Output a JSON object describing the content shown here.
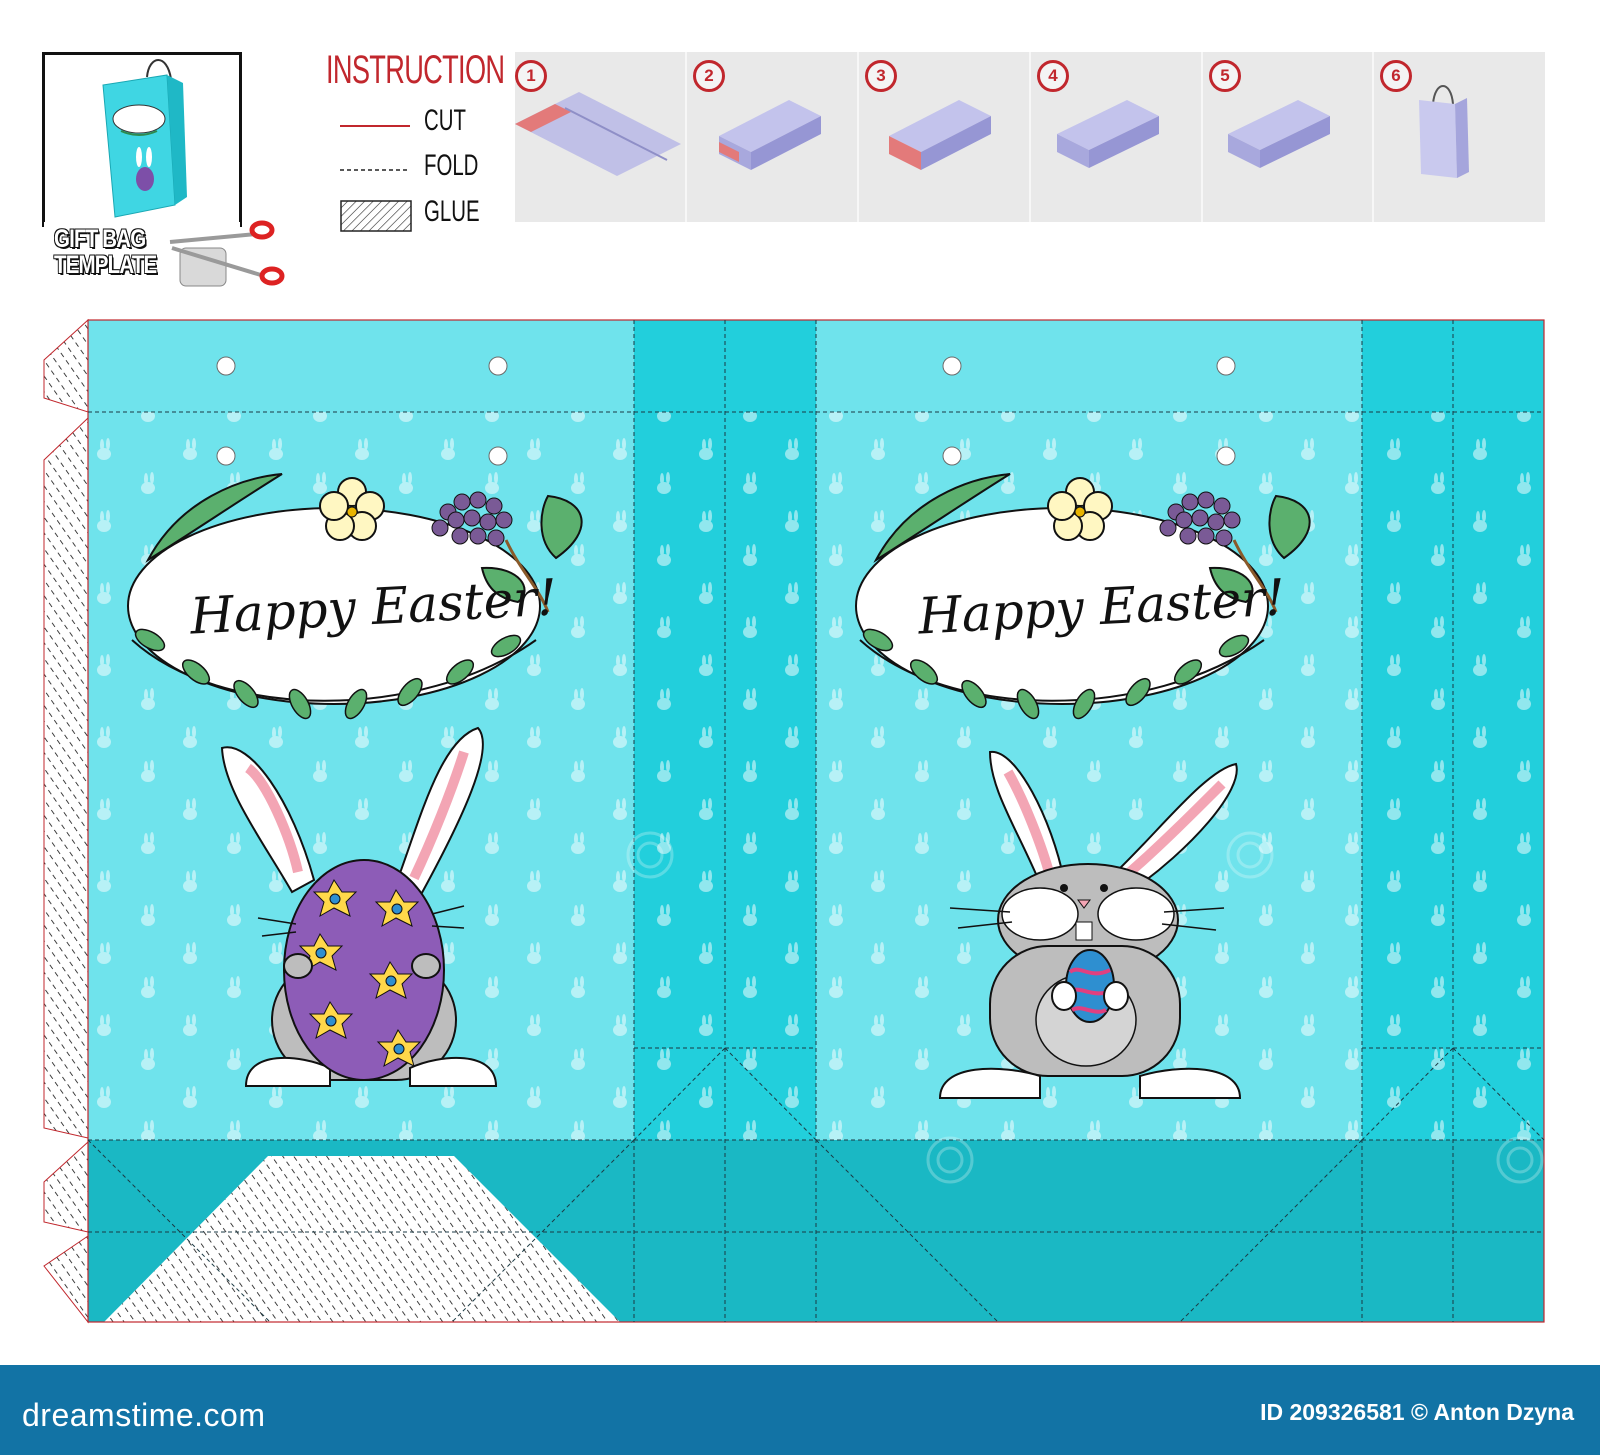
{
  "thumbnail": {
    "label_line1": "GIFT BAG",
    "label_line2": "TEMPLATE"
  },
  "instruction": {
    "title": "INSTRUCTION",
    "legend": [
      {
        "kind": "cut",
        "label": "CUT"
      },
      {
        "kind": "fold",
        "label": "FOLD"
      },
      {
        "kind": "glue",
        "label": "GLUE"
      }
    ],
    "steps": [
      "1",
      "2",
      "3",
      "4",
      "5",
      "6"
    ]
  },
  "template": {
    "front_panel_greeting": "Happy Easter!",
    "back_panel_greeting": "Happy Easter!"
  },
  "colors": {
    "panel": "#6fe3ec",
    "side": "#22cfdc",
    "bottom": "#1ab8c4",
    "cut": "#c1272d",
    "bag_preview": "#c9c9ee"
  },
  "footer": {
    "logo": "dreamstime.com",
    "credit": "ID 209326581 © Anton Dzyna"
  }
}
